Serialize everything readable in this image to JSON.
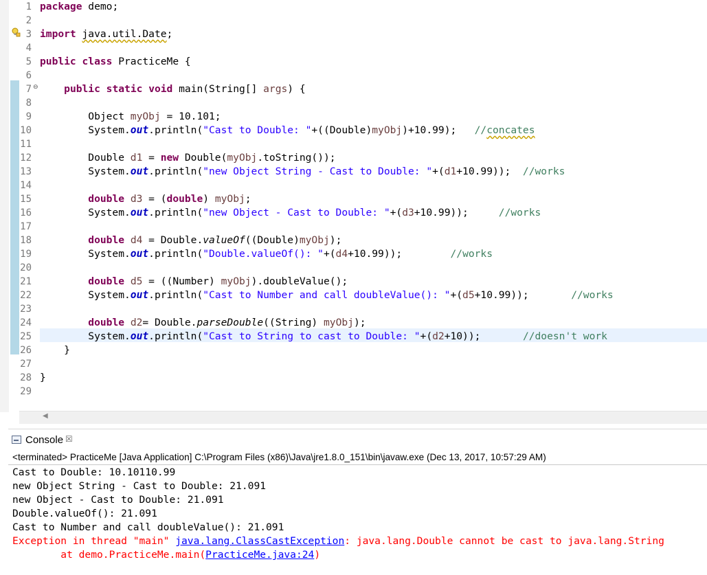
{
  "editor": {
    "lines": [
      {
        "n": "1",
        "segs": [
          {
            "t": "package",
            "c": "kw"
          },
          {
            "t": " demo;",
            "c": ""
          }
        ]
      },
      {
        "n": "2",
        "segs": []
      },
      {
        "n": "3",
        "segs": [
          {
            "t": "import",
            "c": "kw"
          },
          {
            "t": " ",
            "c": ""
          },
          {
            "t": "java.util.Date",
            "c": "warn"
          },
          {
            "t": ";",
            "c": ""
          }
        ]
      },
      {
        "n": "4",
        "segs": []
      },
      {
        "n": "5",
        "segs": [
          {
            "t": "public",
            "c": "kw"
          },
          {
            "t": " ",
            "c": ""
          },
          {
            "t": "class",
            "c": "kw"
          },
          {
            "t": " PracticeMe {",
            "c": ""
          }
        ]
      },
      {
        "n": "6",
        "segs": []
      },
      {
        "n": "7",
        "segs": [
          {
            "t": "    ",
            "c": ""
          },
          {
            "t": "public",
            "c": "kw"
          },
          {
            "t": " ",
            "c": ""
          },
          {
            "t": "static",
            "c": "kw"
          },
          {
            "t": " ",
            "c": ""
          },
          {
            "t": "void",
            "c": "kw"
          },
          {
            "t": " main(String[] ",
            "c": ""
          },
          {
            "t": "args",
            "c": "var"
          },
          {
            "t": ") {",
            "c": ""
          }
        ]
      },
      {
        "n": "8",
        "segs": []
      },
      {
        "n": "9",
        "segs": [
          {
            "t": "        Object ",
            "c": ""
          },
          {
            "t": "myObj",
            "c": "var"
          },
          {
            "t": " = 10.101;",
            "c": ""
          }
        ]
      },
      {
        "n": "10",
        "segs": [
          {
            "t": "        System.",
            "c": ""
          },
          {
            "t": "out",
            "c": "fld"
          },
          {
            "t": ".println(",
            "c": ""
          },
          {
            "t": "\"Cast to Double: \"",
            "c": "str"
          },
          {
            "t": "+((Double)",
            "c": ""
          },
          {
            "t": "myObj",
            "c": "var"
          },
          {
            "t": ")+10.99);   ",
            "c": ""
          },
          {
            "t": "//",
            "c": "cmt"
          },
          {
            "t": "concates",
            "c": "cmt warn"
          }
        ]
      },
      {
        "n": "11",
        "segs": []
      },
      {
        "n": "12",
        "segs": [
          {
            "t": "        Double ",
            "c": ""
          },
          {
            "t": "d1",
            "c": "var"
          },
          {
            "t": " = ",
            "c": ""
          },
          {
            "t": "new",
            "c": "kw"
          },
          {
            "t": " Double(",
            "c": ""
          },
          {
            "t": "myObj",
            "c": "var"
          },
          {
            "t": ".toString());",
            "c": ""
          }
        ]
      },
      {
        "n": "13",
        "segs": [
          {
            "t": "        System.",
            "c": ""
          },
          {
            "t": "out",
            "c": "fld"
          },
          {
            "t": ".println(",
            "c": ""
          },
          {
            "t": "\"new Object String - Cast to Double: \"",
            "c": "str"
          },
          {
            "t": "+(",
            "c": ""
          },
          {
            "t": "d1",
            "c": "var"
          },
          {
            "t": "+10.99));  ",
            "c": ""
          },
          {
            "t": "//works",
            "c": "cmt"
          }
        ]
      },
      {
        "n": "14",
        "segs": []
      },
      {
        "n": "15",
        "segs": [
          {
            "t": "        ",
            "c": ""
          },
          {
            "t": "double",
            "c": "kw"
          },
          {
            "t": " ",
            "c": ""
          },
          {
            "t": "d3",
            "c": "var"
          },
          {
            "t": " = (",
            "c": ""
          },
          {
            "t": "double",
            "c": "kw"
          },
          {
            "t": ") ",
            "c": ""
          },
          {
            "t": "myObj",
            "c": "var"
          },
          {
            "t": ";",
            "c": ""
          }
        ]
      },
      {
        "n": "16",
        "segs": [
          {
            "t": "        System.",
            "c": ""
          },
          {
            "t": "out",
            "c": "fld"
          },
          {
            "t": ".println(",
            "c": ""
          },
          {
            "t": "\"new Object - Cast to Double: \"",
            "c": "str"
          },
          {
            "t": "+(",
            "c": ""
          },
          {
            "t": "d3",
            "c": "var"
          },
          {
            "t": "+10.99));     ",
            "c": ""
          },
          {
            "t": "//works",
            "c": "cmt"
          }
        ]
      },
      {
        "n": "17",
        "segs": []
      },
      {
        "n": "18",
        "segs": [
          {
            "t": "        ",
            "c": ""
          },
          {
            "t": "double",
            "c": "kw"
          },
          {
            "t": " ",
            "c": ""
          },
          {
            "t": "d4",
            "c": "var"
          },
          {
            "t": " = Double.",
            "c": ""
          },
          {
            "t": "valueOf",
            "c": "ital"
          },
          {
            "t": "((Double)",
            "c": ""
          },
          {
            "t": "myObj",
            "c": "var"
          },
          {
            "t": ");",
            "c": ""
          }
        ]
      },
      {
        "n": "19",
        "segs": [
          {
            "t": "        System.",
            "c": ""
          },
          {
            "t": "out",
            "c": "fld"
          },
          {
            "t": ".println(",
            "c": ""
          },
          {
            "t": "\"Double.valueOf(): \"",
            "c": "str"
          },
          {
            "t": "+(",
            "c": ""
          },
          {
            "t": "d4",
            "c": "var"
          },
          {
            "t": "+10.99));        ",
            "c": ""
          },
          {
            "t": "//works",
            "c": "cmt"
          }
        ]
      },
      {
        "n": "20",
        "segs": []
      },
      {
        "n": "21",
        "segs": [
          {
            "t": "        ",
            "c": ""
          },
          {
            "t": "double",
            "c": "kw"
          },
          {
            "t": " ",
            "c": ""
          },
          {
            "t": "d5",
            "c": "var"
          },
          {
            "t": " = ((Number) ",
            "c": ""
          },
          {
            "t": "myObj",
            "c": "var"
          },
          {
            "t": ").doubleValue();",
            "c": ""
          }
        ]
      },
      {
        "n": "22",
        "segs": [
          {
            "t": "        System.",
            "c": ""
          },
          {
            "t": "out",
            "c": "fld"
          },
          {
            "t": ".println(",
            "c": ""
          },
          {
            "t": "\"Cast to Number and call doubleValue(): \"",
            "c": "str"
          },
          {
            "t": "+(",
            "c": ""
          },
          {
            "t": "d5",
            "c": "var"
          },
          {
            "t": "+10.99));       ",
            "c": ""
          },
          {
            "t": "//works",
            "c": "cmt"
          }
        ]
      },
      {
        "n": "23",
        "segs": []
      },
      {
        "n": "24",
        "segs": [
          {
            "t": "        ",
            "c": ""
          },
          {
            "t": "double",
            "c": "kw"
          },
          {
            "t": " ",
            "c": ""
          },
          {
            "t": "d2",
            "c": "var"
          },
          {
            "t": "= Double.",
            "c": ""
          },
          {
            "t": "parseDouble",
            "c": "ital"
          },
          {
            "t": "((String) ",
            "c": ""
          },
          {
            "t": "myObj",
            "c": "var"
          },
          {
            "t": ");",
            "c": ""
          }
        ]
      },
      {
        "n": "25",
        "segs": [
          {
            "t": "        System.",
            "c": ""
          },
          {
            "t": "out",
            "c": "fld"
          },
          {
            "t": ".println(",
            "c": ""
          },
          {
            "t": "\"Cast to String to cast to Double: \"",
            "c": "str"
          },
          {
            "t": "+(",
            "c": ""
          },
          {
            "t": "d2",
            "c": "var"
          },
          {
            "t": "+10));       ",
            "c": ""
          },
          {
            "t": "//doesn't work",
            "c": "cmt"
          }
        ]
      },
      {
        "n": "26",
        "segs": [
          {
            "t": "    }",
            "c": ""
          }
        ]
      },
      {
        "n": "27",
        "segs": []
      },
      {
        "n": "28",
        "segs": [
          {
            "t": "}",
            "c": ""
          }
        ]
      },
      {
        "n": "29",
        "segs": []
      }
    ]
  },
  "console": {
    "title": "Console",
    "close_glyph": "☒",
    "status": "<terminated> PracticeMe [Java Application] C:\\Program Files (x86)\\Java\\jre1.8.0_151\\bin\\javaw.exe (Dec 13, 2017, 10:57:29 AM)",
    "output": [
      [
        {
          "t": "Cast to Double: 10.10110.99",
          "c": ""
        }
      ],
      [
        {
          "t": "new Object String - Cast to Double: 21.091",
          "c": ""
        }
      ],
      [
        {
          "t": "new Object - Cast to Double: 21.091",
          "c": ""
        }
      ],
      [
        {
          "t": "Double.valueOf(): 21.091",
          "c": ""
        }
      ],
      [
        {
          "t": "Cast to Number and call doubleValue(): 21.091",
          "c": ""
        }
      ],
      [
        {
          "t": "Exception in thread \"main\" ",
          "c": "err"
        },
        {
          "t": "java.lang.ClassCastException",
          "c": "link"
        },
        {
          "t": ": java.lang.Double cannot be cast to java.lang.String",
          "c": "err"
        }
      ],
      [
        {
          "t": "\tat demo.PracticeMe.main(",
          "c": "err"
        },
        {
          "t": "PracticeMe.java:24",
          "c": "link"
        },
        {
          "t": ")",
          "c": "err"
        }
      ]
    ]
  },
  "colors": {
    "keyword": "#7f0055",
    "string": "#2a00ff",
    "comment": "#3f7f5f",
    "error": "#ff0000",
    "link": "#0000ff"
  }
}
